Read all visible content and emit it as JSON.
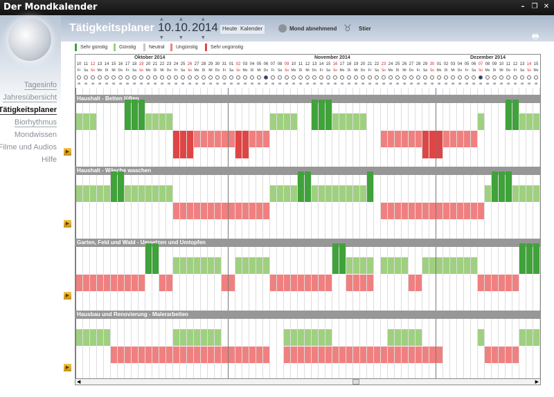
{
  "window": {
    "title": "Der Mondkalender"
  },
  "nav": [
    {
      "label": "Tagesinfo",
      "active": false
    },
    {
      "label": "Jahresübersicht",
      "active": false
    },
    {
      "label": "Tätigkeitsplaner",
      "active": true
    },
    {
      "label": "Biorhythmus",
      "active": false
    },
    {
      "label": "Mondwissen",
      "active": false
    },
    {
      "label": "Filme und Audios",
      "active": false
    },
    {
      "label": "Hilfe",
      "active": false
    }
  ],
  "header": {
    "title": "Tätigkeitsplaner",
    "day": "10.",
    "month": "10.",
    "year": "2014",
    "today_label": "Heute",
    "calendar_label": "Kalender",
    "moon_phase": "Mond abnehmend",
    "zodiac": "Stier"
  },
  "legend": [
    {
      "label": "Sehr günstig",
      "color": "#3fa23a"
    },
    {
      "label": "Günstig",
      "color": "#9fd07f"
    },
    {
      "label": "Neutral",
      "color": "#c6c6c6"
    },
    {
      "label": "Ungünstig",
      "color": "#f08080"
    },
    {
      "label": "Sehr ungünstig",
      "color": "#e04545"
    }
  ],
  "months": [
    "Oktober 2014",
    "November 2014",
    "Dezember 2014"
  ],
  "days": [
    {
      "d": "10",
      "wd": "Fr"
    },
    {
      "d": "11",
      "wd": "Sa"
    },
    {
      "d": "12",
      "wd": "So"
    },
    {
      "d": "13",
      "wd": "Mo"
    },
    {
      "d": "14",
      "wd": "Di"
    },
    {
      "d": "15",
      "wd": "Mi"
    },
    {
      "d": "16",
      "wd": "Do"
    },
    {
      "d": "17",
      "wd": "Fr"
    },
    {
      "d": "18",
      "wd": "Sa"
    },
    {
      "d": "19",
      "wd": "So"
    },
    {
      "d": "20",
      "wd": "Mo"
    },
    {
      "d": "21",
      "wd": "Di"
    },
    {
      "d": "22",
      "wd": "Mi"
    },
    {
      "d": "23",
      "wd": "Do"
    },
    {
      "d": "24",
      "wd": "Fr"
    },
    {
      "d": "25",
      "wd": "Sa"
    },
    {
      "d": "26",
      "wd": "So"
    },
    {
      "d": "27",
      "wd": "Mo"
    },
    {
      "d": "28",
      "wd": "Di"
    },
    {
      "d": "29",
      "wd": "Mi"
    },
    {
      "d": "30",
      "wd": "Do"
    },
    {
      "d": "31",
      "wd": "Fr"
    },
    {
      "d": "01",
      "wd": "Sa"
    },
    {
      "d": "02",
      "wd": "So"
    },
    {
      "d": "03",
      "wd": "Mo"
    },
    {
      "d": "04",
      "wd": "Di"
    },
    {
      "d": "05",
      "wd": "Mi"
    },
    {
      "d": "06",
      "wd": "Do"
    },
    {
      "d": "07",
      "wd": "Fr"
    },
    {
      "d": "08",
      "wd": "Sa"
    },
    {
      "d": "09",
      "wd": "So"
    },
    {
      "d": "10",
      "wd": "Mo"
    },
    {
      "d": "11",
      "wd": "Di"
    },
    {
      "d": "12",
      "wd": "Mi"
    },
    {
      "d": "13",
      "wd": "Do"
    },
    {
      "d": "14",
      "wd": "Fr"
    },
    {
      "d": "15",
      "wd": "Sa"
    },
    {
      "d": "16",
      "wd": "So"
    },
    {
      "d": "17",
      "wd": "Mo"
    },
    {
      "d": "18",
      "wd": "Di"
    },
    {
      "d": "19",
      "wd": "Mi"
    },
    {
      "d": "20",
      "wd": "Do"
    },
    {
      "d": "21",
      "wd": "Fr"
    },
    {
      "d": "22",
      "wd": "Sa"
    },
    {
      "d": "23",
      "wd": "So"
    },
    {
      "d": "24",
      "wd": "Mo"
    },
    {
      "d": "25",
      "wd": "Di"
    },
    {
      "d": "26",
      "wd": "Mi"
    },
    {
      "d": "27",
      "wd": "Do"
    },
    {
      "d": "28",
      "wd": "Fr"
    },
    {
      "d": "29",
      "wd": "Sa"
    },
    {
      "d": "30",
      "wd": "So"
    },
    {
      "d": "01",
      "wd": "Mo"
    },
    {
      "d": "02",
      "wd": "Di"
    },
    {
      "d": "03",
      "wd": "Mi"
    },
    {
      "d": "04",
      "wd": "Do"
    },
    {
      "d": "05",
      "wd": "Fr"
    },
    {
      "d": "06",
      "wd": "Sa"
    },
    {
      "d": "07",
      "wd": "So"
    },
    {
      "d": "08",
      "wd": "Mo"
    },
    {
      "d": "09",
      "wd": "Di"
    },
    {
      "d": "10",
      "wd": "Mi"
    },
    {
      "d": "11",
      "wd": "Do"
    },
    {
      "d": "12",
      "wd": "Fr"
    },
    {
      "d": "13",
      "wd": "Sa"
    },
    {
      "d": "14",
      "wd": "So"
    },
    {
      "d": "15",
      "wd": "Mo"
    }
  ],
  "activities": [
    {
      "title": "Haushalt - Betten lüften",
      "good": [
        [
          0,
          3,
          1
        ],
        [
          7,
          10,
          2
        ],
        [
          10,
          14,
          1
        ],
        [
          28,
          32,
          1
        ],
        [
          34,
          35,
          2
        ],
        [
          35,
          37,
          2
        ],
        [
          37,
          42,
          1
        ],
        [
          58,
          59,
          1
        ],
        [
          62,
          64,
          2
        ],
        [
          64,
          67,
          1
        ]
      ],
      "bad": [
        [
          14,
          17,
          2
        ],
        [
          17,
          23,
          1
        ],
        [
          23,
          25,
          2
        ],
        [
          25,
          28,
          1
        ],
        [
          44,
          50,
          1
        ],
        [
          50,
          53,
          2
        ],
        [
          53,
          58,
          1
        ]
      ]
    },
    {
      "title": "Haushalt - Wäsche waschen",
      "good": [
        [
          0,
          5,
          1
        ],
        [
          5,
          7,
          2
        ],
        [
          7,
          14,
          1
        ],
        [
          28,
          32,
          1
        ],
        [
          32,
          34,
          2
        ],
        [
          34,
          42,
          1
        ],
        [
          42,
          43,
          2
        ],
        [
          59,
          60,
          1
        ],
        [
          60,
          63,
          2
        ],
        [
          63,
          67,
          1
        ]
      ],
      "bad": [
        [
          14,
          28,
          1
        ],
        [
          44,
          59,
          1
        ]
      ]
    },
    {
      "title": "Garten, Feld und Wald - Umsetzen und Umtopfen",
      "good": [
        [
          10,
          12,
          2
        ],
        [
          14,
          21,
          1
        ],
        [
          23,
          28,
          1
        ],
        [
          37,
          39,
          2
        ],
        [
          39,
          43,
          1
        ],
        [
          44,
          48,
          1
        ],
        [
          50,
          58,
          1
        ],
        [
          64,
          67,
          2
        ]
      ],
      "bad": [
        [
          0,
          10,
          1
        ],
        [
          12,
          14,
          1
        ],
        [
          21,
          23,
          1
        ],
        [
          28,
          37,
          1
        ],
        [
          39,
          43,
          1
        ],
        [
          48,
          50,
          1
        ],
        [
          58,
          64,
          1
        ]
      ]
    },
    {
      "title": "Hausbau und Renovierung - Malerarbeiten",
      "good": [
        [
          0,
          5,
          1
        ],
        [
          14,
          21,
          1
        ],
        [
          30,
          37,
          1
        ],
        [
          45,
          50,
          1
        ],
        [
          58,
          59,
          1
        ],
        [
          64,
          67,
          1
        ]
      ],
      "bad": [
        [
          5,
          14,
          1
        ],
        [
          14,
          28,
          1
        ],
        [
          30,
          44,
          1
        ],
        [
          44,
          53,
          1
        ],
        [
          59,
          64,
          1
        ]
      ]
    }
  ]
}
